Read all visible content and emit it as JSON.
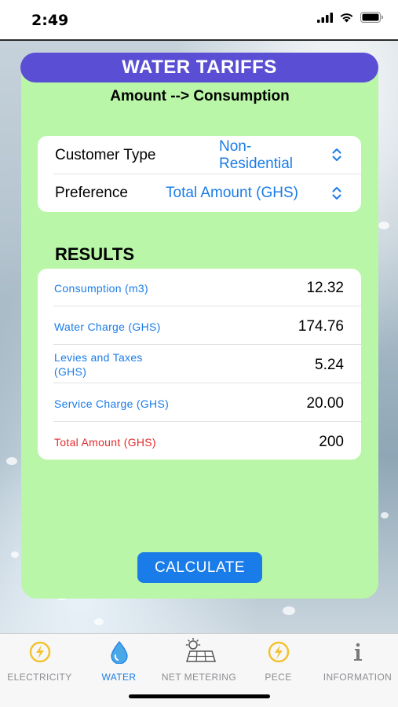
{
  "status": {
    "time": "2:49"
  },
  "header": {
    "title": "WATER TARIFFS",
    "subtitle": "Amount --> Consumption"
  },
  "form": {
    "customer_type": {
      "label": "Customer Type",
      "value_line1": "Non-",
      "value_line2": "Residential"
    },
    "preference": {
      "label": "Preference",
      "value": "Total Amount (GHS)"
    }
  },
  "results": {
    "title": "RESULTS",
    "rows": [
      {
        "label": "Consumption (m3)",
        "value": "12.32"
      },
      {
        "label_line1": "Water Charge (GHS)",
        "value": "174.76"
      },
      {
        "label_line1": "Levies and Taxes",
        "label_line2": "(GHS)",
        "value": "5.24"
      },
      {
        "label_line1": "Service Charge (GHS)",
        "value": "20.00"
      },
      {
        "label_line1": "Total Amount (GHS)",
        "value": "200"
      }
    ]
  },
  "calculate_label": "CALCULATE",
  "tabs": [
    {
      "label": "ELECTRICITY",
      "icon": "lightning-icon",
      "active": false
    },
    {
      "label": "WATER",
      "icon": "water-drop-icon",
      "active": true
    },
    {
      "label": "NET METERING",
      "icon": "solar-panel-icon",
      "active": false
    },
    {
      "label": "PECE",
      "icon": "lightning-icon",
      "active": false
    },
    {
      "label": "INFORMATION",
      "icon": "info-icon",
      "active": false
    }
  ],
  "colors": {
    "accent": "#1a7ce8",
    "panel": "#b9f6a8",
    "title_bar": "#5a4fd4",
    "total_label": "#e32b2b",
    "tab_icon_yellow": "#f2c230"
  }
}
